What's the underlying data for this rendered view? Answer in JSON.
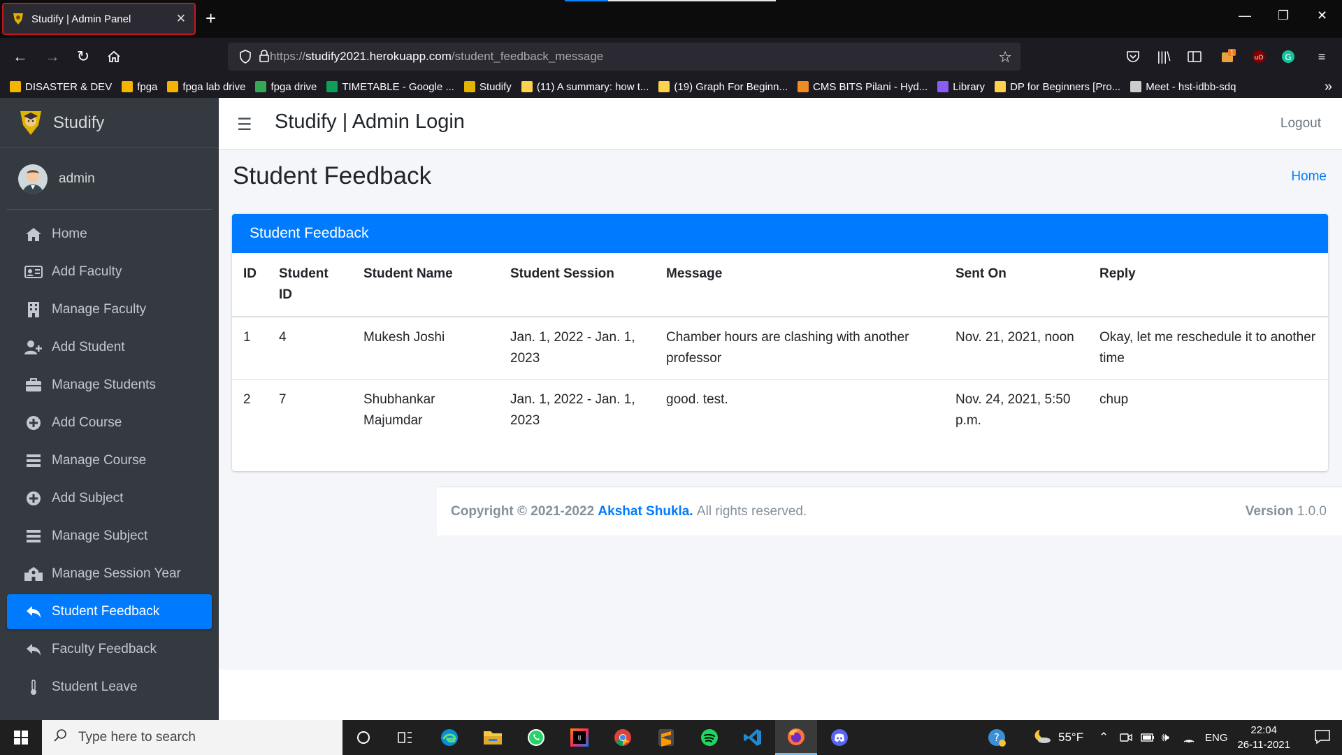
{
  "browser": {
    "tab_title": "Studify | Admin Panel",
    "url_prefix": "https://",
    "url_host": "studify2021.herokuapp.com",
    "url_path": "/student_feedback_message",
    "bookmarks": [
      {
        "label": "DISASTER & DEV",
        "color": "#f4b400"
      },
      {
        "label": "fpga",
        "color": "#f4b400"
      },
      {
        "label": "fpga lab drive",
        "color": "#f4b400"
      },
      {
        "label": "fpga drive",
        "color": "#34a853"
      },
      {
        "label": "TIMETABLE - Google ...",
        "color": "#0f9d58"
      },
      {
        "label": "Studify",
        "color": "#e0b400"
      },
      {
        "label": "(11) A summary: how t...",
        "color": "#ffd24d"
      },
      {
        "label": "(19) Graph For Beginn...",
        "color": "#ffd24d"
      },
      {
        "label": "CMS BITS Pilani - Hyd...",
        "color": "#f08a24"
      },
      {
        "label": "Library",
        "color": "#8a5cf6"
      },
      {
        "label": "DP for Beginners [Pro...",
        "color": "#ffd24d"
      },
      {
        "label": "Meet - hst-idbb-sdq",
        "color": "#cccccc"
      }
    ]
  },
  "sidebar": {
    "brand": "Studify",
    "user": "admin",
    "items": [
      {
        "label": "Home",
        "icon": "home-icon"
      },
      {
        "label": "Add Faculty",
        "icon": "id-card-icon"
      },
      {
        "label": "Manage Faculty",
        "icon": "building-icon"
      },
      {
        "label": "Add Student",
        "icon": "user-plus-icon"
      },
      {
        "label": "Manage Students",
        "icon": "briefcase-icon"
      },
      {
        "label": "Add Course",
        "icon": "plus-circle-icon"
      },
      {
        "label": "Manage Course",
        "icon": "list-icon"
      },
      {
        "label": "Add Subject",
        "icon": "plus-circle-icon"
      },
      {
        "label": "Manage Subject",
        "icon": "list-icon"
      },
      {
        "label": "Manage Session Year",
        "icon": "school-icon"
      },
      {
        "label": "Student Feedback",
        "icon": "reply-icon",
        "active": true
      },
      {
        "label": "Faculty Feedback",
        "icon": "reply-icon"
      },
      {
        "label": "Student Leave",
        "icon": "thermometer-icon"
      }
    ]
  },
  "header": {
    "app_title": "Studify | Admin Login",
    "logout": "Logout"
  },
  "page": {
    "title": "Student Feedback",
    "breadcrumb": "Home"
  },
  "card": {
    "title": "Student Feedback",
    "columns": [
      "ID",
      "Student ID",
      "Student Name",
      "Student Session",
      "Message",
      "Sent On",
      "Reply"
    ],
    "rows": [
      [
        "1",
        "4",
        "Mukesh Joshi",
        "Jan. 1, 2022 - Jan. 1, 2023",
        "Chamber hours are clashing with another professor",
        "Nov. 21, 2021, noon",
        "Okay, let me reschedule it to another time"
      ],
      [
        "2",
        "7",
        "Shubhankar Majumdar",
        "Jan. 1, 2022 - Jan. 1, 2023",
        "good. test.",
        "Nov. 24, 2021, 5:50 p.m.",
        "chup"
      ]
    ]
  },
  "footer": {
    "copyright": "Copyright © 2021-2022",
    "author": "Akshat Shukla.",
    "rights": "All rights reserved.",
    "version_label": "Version",
    "version": "1.0.0"
  },
  "taskbar": {
    "search_placeholder": "Type here to search",
    "weather": "55°F",
    "language": "ENG",
    "time": "22:04",
    "date": "26-11-2021"
  },
  "colors": {
    "primary": "#007bff",
    "sidebar_bg": "#343a40",
    "content_bg": "#f4f6f9"
  }
}
